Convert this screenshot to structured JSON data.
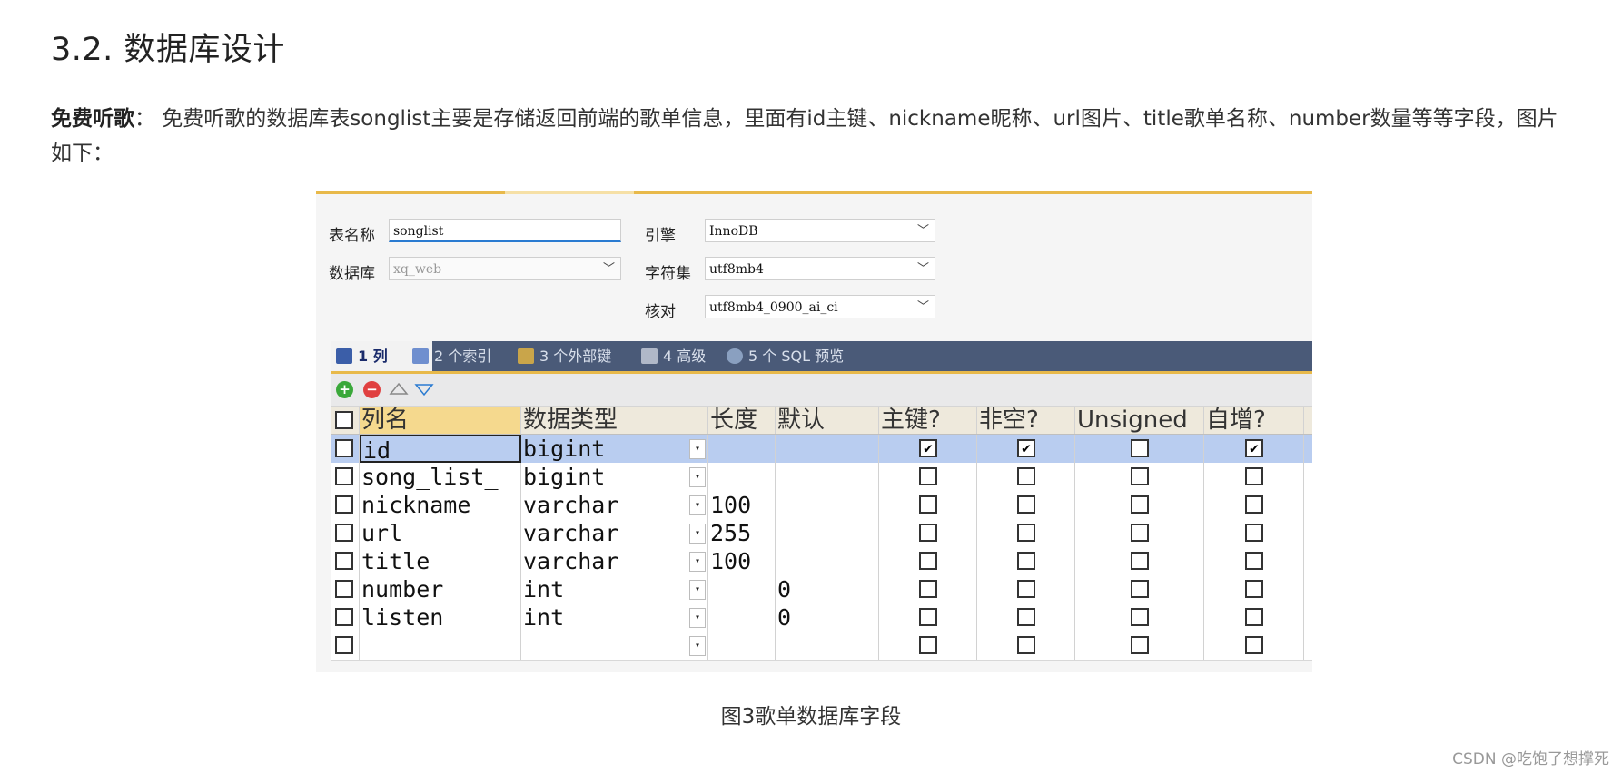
{
  "heading": "3.2. 数据库设计",
  "paragraph": {
    "bold": "免费听歌",
    "text": "： 免费听歌的数据库表songlist主要是存储返回前端的歌单信息，里面有id主键、nickname昵称、url图片、title歌单名称、number数量等等字段，图片如下："
  },
  "form": {
    "table_name_label": "表名称",
    "table_name_value": "songlist",
    "database_label": "数据库",
    "database_value": "xq_web",
    "engine_label": "引擎",
    "engine_value": "InnoDB",
    "charset_label": "字符集",
    "charset_value": "utf8mb4",
    "collation_label": "核对",
    "collation_value": "utf8mb4_0900_ai_ci"
  },
  "tabs": [
    {
      "label": "1 列",
      "icon": "columns-icon"
    },
    {
      "label": "2 个索引",
      "icon": "index-icon"
    },
    {
      "label": "3 个外部键",
      "icon": "foreign-key-icon"
    },
    {
      "label": "4 高级",
      "icon": "advanced-icon"
    },
    {
      "label": "5 个 SQL 预览",
      "icon": "sql-preview-icon"
    }
  ],
  "grid": {
    "headers": [
      "列名",
      "数据类型",
      "长度",
      "默认",
      "主键?",
      "非空?",
      "Unsigned",
      "自增?"
    ],
    "rows": [
      {
        "name": "id",
        "type": "bigint",
        "length": "",
        "default": "",
        "pk": true,
        "notnull": true,
        "unsigned": false,
        "autoinc": true
      },
      {
        "name": "song_list_",
        "type": "bigint",
        "length": "",
        "default": "",
        "pk": false,
        "notnull": false,
        "unsigned": false,
        "autoinc": false
      },
      {
        "name": "nickname",
        "type": "varchar",
        "length": "100",
        "default": "",
        "pk": false,
        "notnull": false,
        "unsigned": false,
        "autoinc": false
      },
      {
        "name": "url",
        "type": "varchar",
        "length": "255",
        "default": "",
        "pk": false,
        "notnull": false,
        "unsigned": false,
        "autoinc": false
      },
      {
        "name": "title",
        "type": "varchar",
        "length": "100",
        "default": "",
        "pk": false,
        "notnull": false,
        "unsigned": false,
        "autoinc": false
      },
      {
        "name": "number",
        "type": "int",
        "length": "",
        "default": "0",
        "pk": false,
        "notnull": false,
        "unsigned": false,
        "autoinc": false
      },
      {
        "name": "listen",
        "type": "int",
        "length": "",
        "default": "0",
        "pk": false,
        "notnull": false,
        "unsigned": false,
        "autoinc": false
      },
      {
        "name": "",
        "type": "",
        "length": "",
        "default": "",
        "pk": false,
        "notnull": false,
        "unsigned": false,
        "autoinc": false
      }
    ]
  },
  "caption": "图3歌单数据库字段",
  "watermark": "CSDN @吃饱了想撑死"
}
